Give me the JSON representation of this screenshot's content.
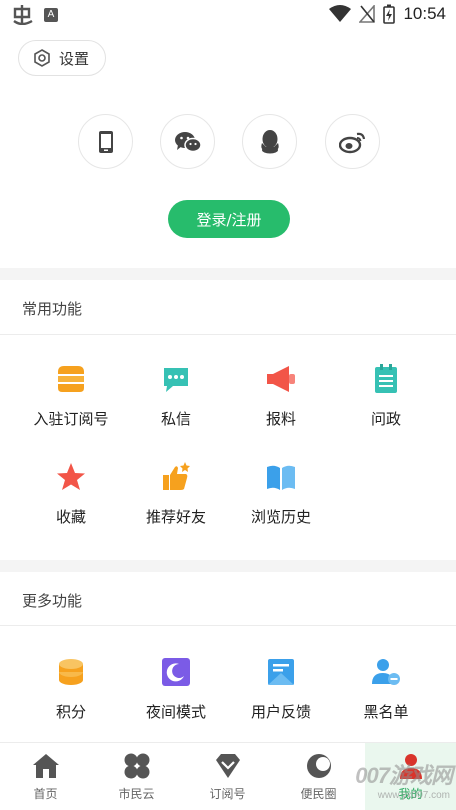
{
  "status_bar": {
    "time": "10:54",
    "a_badge": "A"
  },
  "settings": {
    "label": "设置"
  },
  "login": {
    "options": [
      {
        "name": "phone",
        "icon": "phone-icon"
      },
      {
        "name": "wechat",
        "icon": "wechat-icon"
      },
      {
        "name": "qq",
        "icon": "qq-icon"
      },
      {
        "name": "weibo",
        "icon": "weibo-icon"
      }
    ],
    "button_label": "登录/注册"
  },
  "common": {
    "title": "常用功能",
    "items": [
      {
        "label": "入驻订阅号",
        "icon": "storefront-icon"
      },
      {
        "label": "私信",
        "icon": "message-icon"
      },
      {
        "label": "报料",
        "icon": "megaphone-icon"
      },
      {
        "label": "问政",
        "icon": "notepad-icon"
      },
      {
        "label": "收藏",
        "icon": "star-icon"
      },
      {
        "label": "推荐好友",
        "icon": "thumbs-up-icon"
      },
      {
        "label": "浏览历史",
        "icon": "book-icon"
      }
    ]
  },
  "more": {
    "title": "更多功能",
    "items": [
      {
        "label": "积分",
        "icon": "coins-icon"
      },
      {
        "label": "夜间模式",
        "icon": "moon-icon"
      },
      {
        "label": "用户反馈",
        "icon": "feedback-icon"
      },
      {
        "label": "黑名单",
        "icon": "user-block-icon"
      }
    ]
  },
  "bottom_nav": {
    "items": [
      {
        "label": "首页",
        "icon": "home-icon"
      },
      {
        "label": "市民云",
        "icon": "clover-icon"
      },
      {
        "label": "订阅号",
        "icon": "diamond-icon"
      },
      {
        "label": "便民圈",
        "icon": "circle-icon"
      },
      {
        "label": "我的",
        "icon": "person-icon",
        "active": true
      }
    ]
  },
  "watermark": {
    "text": "007游戏网",
    "url": "www.yx007.com"
  },
  "colors": {
    "brand_green": "#27bc6c",
    "orange": "#f6a11e",
    "teal": "#36c1b4",
    "red": "#f25548",
    "blue": "#3ba0ea"
  }
}
